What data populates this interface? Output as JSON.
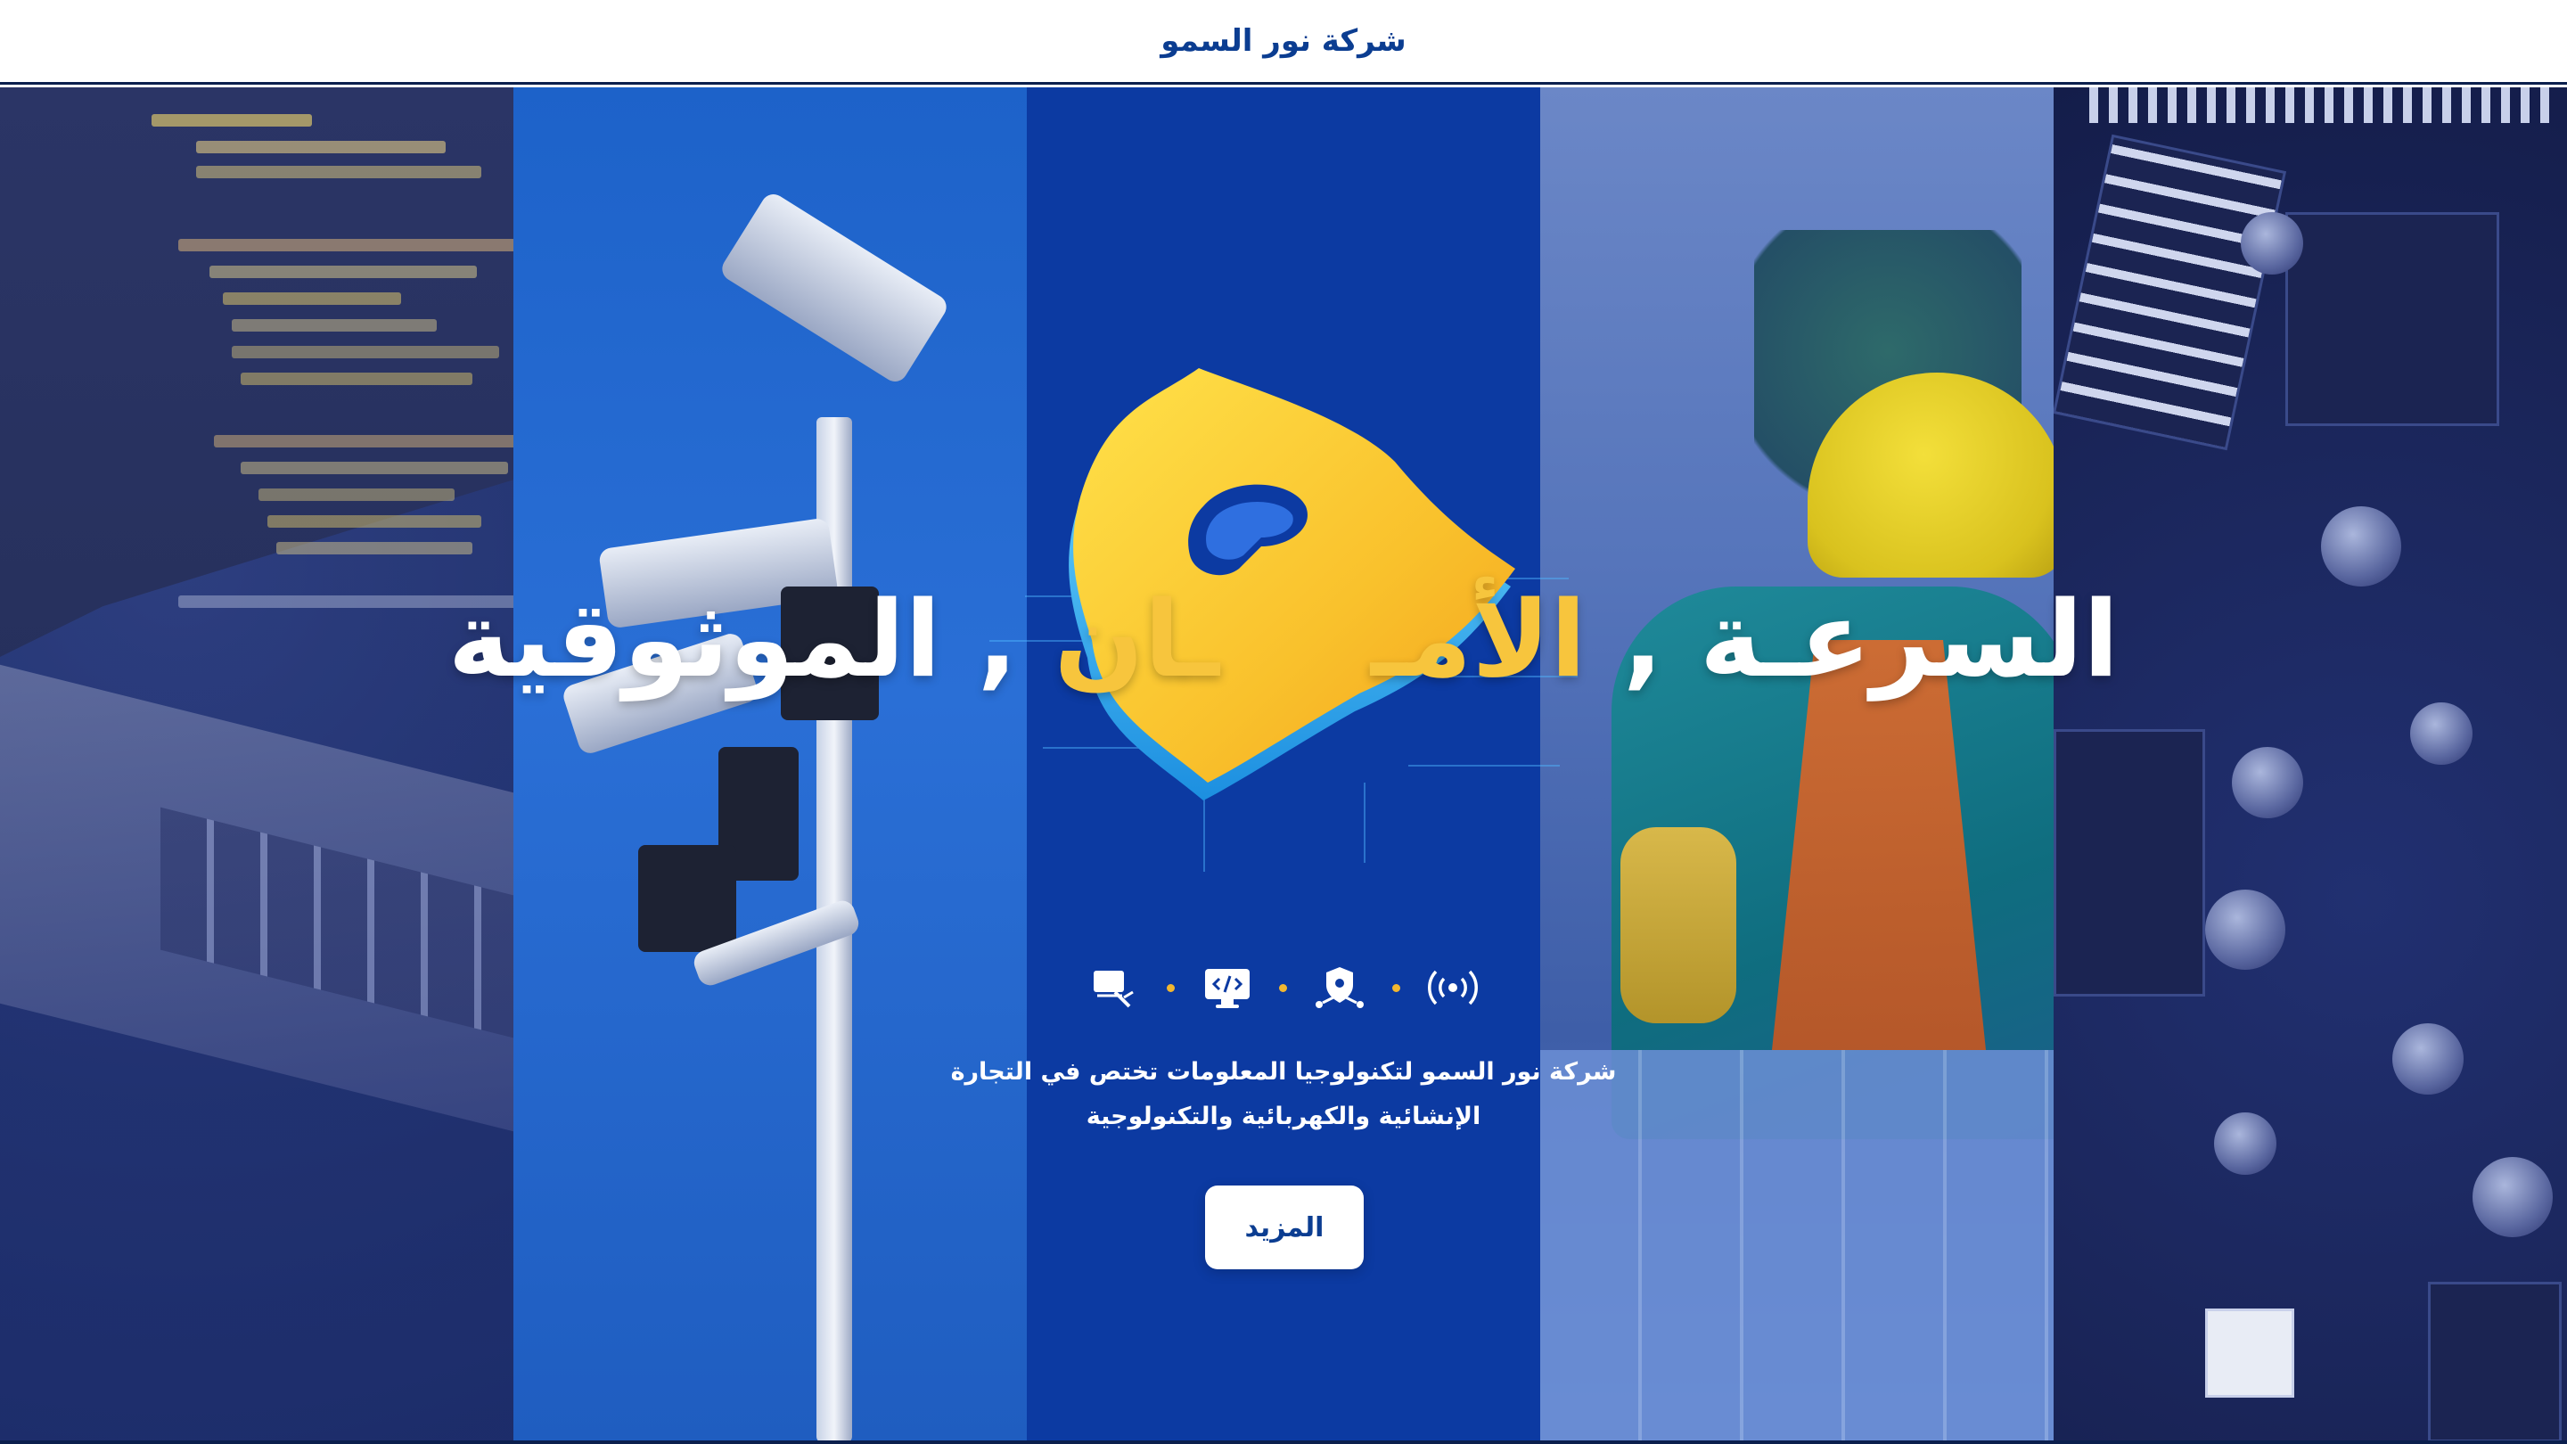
{
  "header": {
    "brand": "شركة نور السمو"
  },
  "hero": {
    "headline": {
      "part_white_1": "السرعـة ,",
      "part_gold": "الأمـ",
      "part_gold_2": "ـان",
      "part_white_2": ", الموثوقية"
    },
    "service_icons": [
      "wireless-signal-icon",
      "security-network-icon",
      "code-monitor-icon",
      "solar-panel-icon"
    ],
    "description_line_1": "شركة نور السمو لتكنولوجيا المعلومات تختص في التجارة",
    "description_line_2": "الإنشائية والكهربائية والتكنولوجية",
    "more_button": "المزيد"
  },
  "colors": {
    "brand_blue": "#0b3d91",
    "accent_gold": "#f7c53d",
    "hero_blue": "#0c3aa2",
    "white": "#ffffff"
  }
}
